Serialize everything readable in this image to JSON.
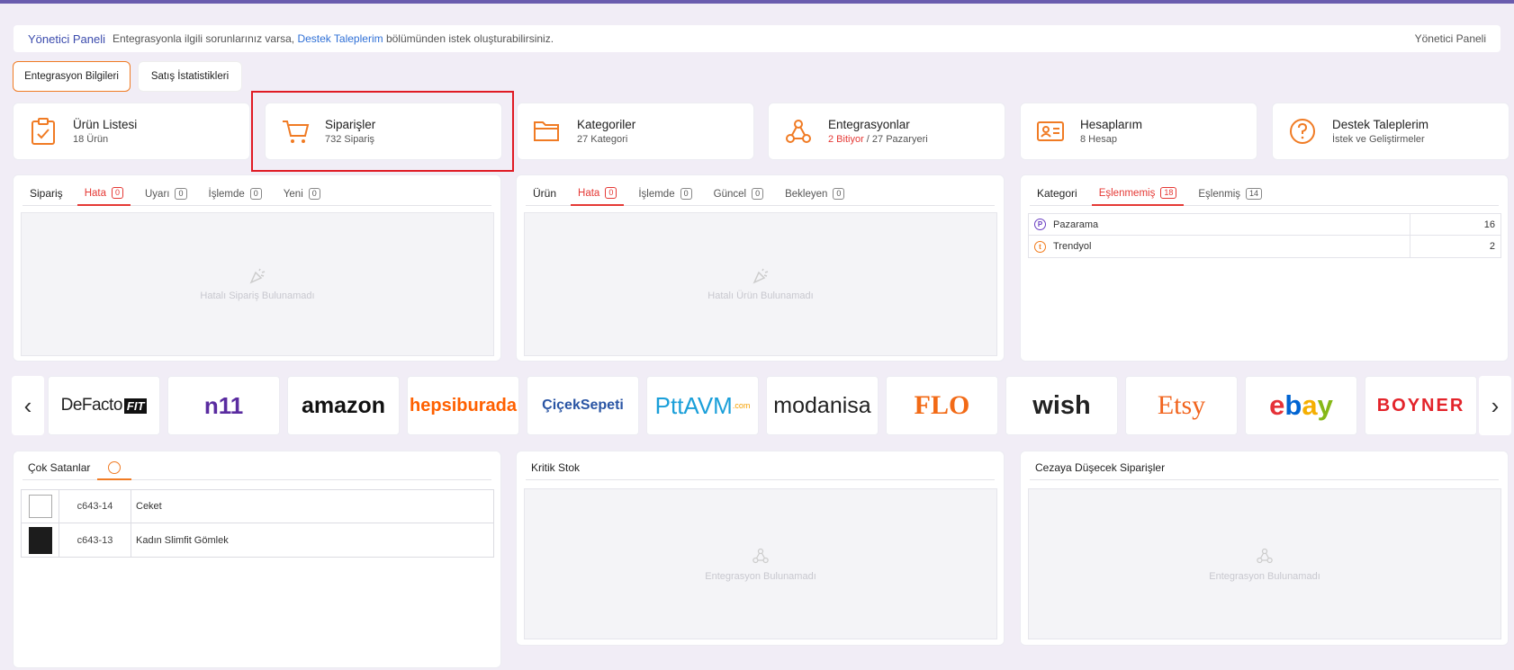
{
  "header": {
    "title": "Yönetici Paneli",
    "message_before": "Entegrasyonla ilgili sorunlarınız varsa,",
    "link": "Destek Taleplerim",
    "message_after": "bölümünden istek oluşturabilirsiniz.",
    "breadcrumb": "Yönetici Paneli"
  },
  "tabs": [
    "Entegrasyon Bilgileri",
    "Satış İstatistikleri"
  ],
  "stats": [
    {
      "title": "Ürün Listesi",
      "sub": "18 Ürün",
      "icon": "clipboard-check-icon"
    },
    {
      "title": "Siparişler",
      "sub": "732 Sipariş",
      "icon": "cart-icon"
    },
    {
      "title": "Kategoriler",
      "sub": "27 Kategori",
      "icon": "folder-icon"
    },
    {
      "title": "Entegrasyonlar",
      "sub_red": "2 Bitiyor",
      "sub_rest": " / 27 Pazaryeri",
      "icon": "webhook-icon"
    },
    {
      "title": "Hesaplarım",
      "sub": "8 Hesap",
      "icon": "id-card-icon"
    },
    {
      "title": "Destek Taleplerim",
      "sub": "İstek ve Geliştirmeler",
      "icon": "question-circle-icon"
    }
  ],
  "order_panel": {
    "tabs": [
      {
        "label": "Sipariş"
      },
      {
        "label": "Hata",
        "count": "0"
      },
      {
        "label": "Uyarı",
        "count": "0"
      },
      {
        "label": "İşlemde",
        "count": "0"
      },
      {
        "label": "Yeni",
        "count": "0"
      }
    ],
    "empty": "Hatalı Sipariş Bulunamadı"
  },
  "product_panel": {
    "tabs": [
      {
        "label": "Ürün"
      },
      {
        "label": "Hata",
        "count": "0"
      },
      {
        "label": "İşlemde",
        "count": "0"
      },
      {
        "label": "Güncel",
        "count": "0"
      },
      {
        "label": "Bekleyen",
        "count": "0"
      }
    ],
    "empty": "Hatalı Ürün Bulunamadı"
  },
  "category_panel": {
    "tabs": [
      {
        "label": "Kategori"
      },
      {
        "label": "Eşlenmemiş",
        "count": "18"
      },
      {
        "label": "Eşlenmiş",
        "count": "14"
      }
    ],
    "rows": [
      {
        "name": "Pazarama",
        "count": "16",
        "color": "#6a3ec2",
        "glyph": "P"
      },
      {
        "name": "Trendyol",
        "count": "2",
        "color": "#f27a1a",
        "glyph": "t"
      }
    ]
  },
  "marketplaces": [
    "DeFacto",
    "FIT",
    "n11",
    "amazon",
    "hepsiburada",
    "ÇiçekSepeti",
    "PttAVM",
    ".com",
    "modanisa",
    "FLO",
    "wish",
    "Etsy",
    "ebay",
    "BOYNER"
  ],
  "bestsellers": {
    "title": "Çok Satanlar",
    "rows": [
      {
        "code": "c643-14",
        "name": "Ceket"
      },
      {
        "code": "c643-13",
        "name": "Kadın Slimfit Gömlek"
      }
    ]
  },
  "critical_stock": {
    "title": "Kritik Stok",
    "empty": "Entegrasyon Bulunamadı"
  },
  "penalty_orders": {
    "title": "Cezaya Düşecek Siparişler",
    "empty": "Entegrasyon Bulunamadı"
  },
  "colors": {
    "accent": "#f07b24",
    "brand": "#3c4cad",
    "error": "#e53935",
    "highlight": "#e01b24"
  }
}
